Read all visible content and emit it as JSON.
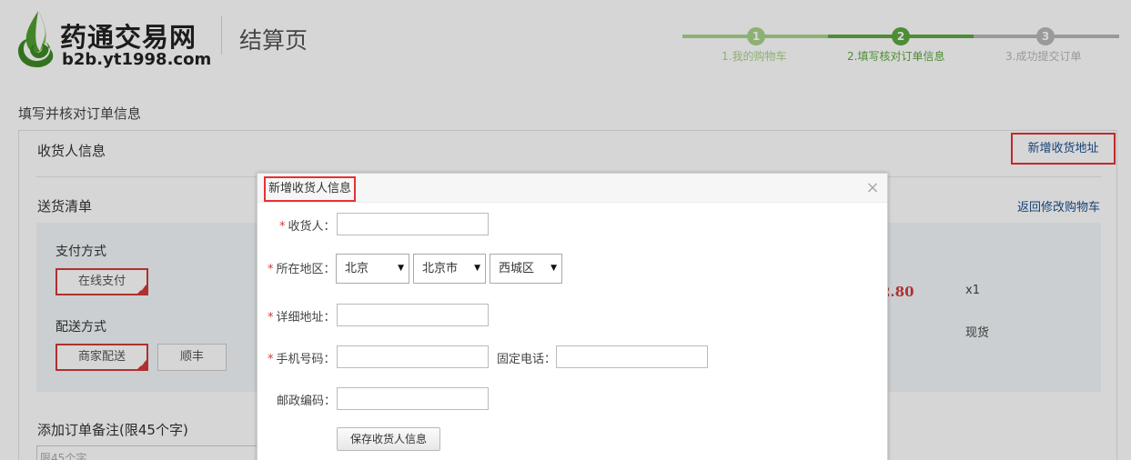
{
  "header": {
    "logo_name": "药通交易网",
    "logo_domain": "b2b.yt1998.com",
    "page_title": "结算页"
  },
  "steps": [
    {
      "number": "1",
      "label": "1.我的购物车",
      "state": "done"
    },
    {
      "number": "2",
      "label": "2.填写核对订单信息",
      "state": "current"
    },
    {
      "number": "3",
      "label": "3.成功提交订单",
      "state": "todo"
    }
  ],
  "colors": {
    "step_done": "#a9d38a",
    "step_current": "#5da93e",
    "step_todo": "#b8b8b8",
    "accent_red": "#d13a3a",
    "link_blue": "#1a4f8f",
    "highlight_red": "#e63232"
  },
  "page": {
    "section_heading": "填写并核对订单信息",
    "consignee_title": "收货人信息",
    "add_address_link": "新增收货地址",
    "delivery_title": "送货清单",
    "back_to_cart_link": "返回修改购物车",
    "payment_label": "支付方式",
    "payment_options": [
      "在线支付"
    ],
    "shipping_label": "配送方式",
    "shipping_options": [
      "商家配送",
      "顺丰"
    ],
    "price_fragment": "2.80",
    "quantity": "x1",
    "stock_status": "现货",
    "remark_title": "添加订单备注(限45个字)",
    "remark_placeholder": "限45个字"
  },
  "modal": {
    "title": "新增收货人信息",
    "close_glyph": "×",
    "consignee_label": "收货人：",
    "region_label": "所在地区：",
    "province": "北京",
    "city": "北京市",
    "district": "西城区",
    "address_label": "详细地址：",
    "mobile_label": "手机号码：",
    "phone_label": "固定电话：",
    "zip_label": "邮政编码：",
    "required_mark": "*",
    "save_button": "保存收货人信息"
  }
}
